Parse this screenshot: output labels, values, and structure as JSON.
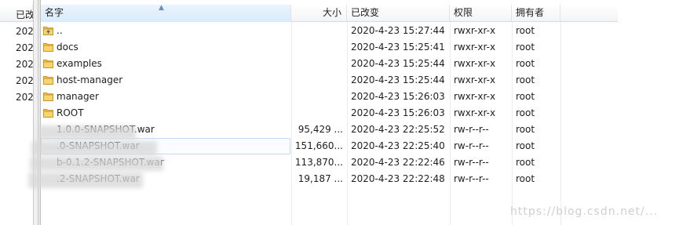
{
  "left_pane": {
    "header": "已改",
    "rows": [
      "202",
      "202",
      "202",
      "202",
      "202"
    ]
  },
  "columns": {
    "name": "名字",
    "size": "大小",
    "modified": "已改变",
    "permissions": "权限",
    "owner": "拥有者"
  },
  "files": [
    {
      "type": "parent",
      "name": "..",
      "size": "",
      "modified": "2020-4-23 15:27:44",
      "permissions": "rwxr-xr-x",
      "owner": "root"
    },
    {
      "type": "folder",
      "name": "docs",
      "size": "",
      "modified": "2020-4-23 15:25:41",
      "permissions": "rwxr-xr-x",
      "owner": "root"
    },
    {
      "type": "folder",
      "name": "examples",
      "size": "",
      "modified": "2020-4-23 15:25:44",
      "permissions": "rwxr-xr-x",
      "owner": "root"
    },
    {
      "type": "folder",
      "name": "host-manager",
      "size": "",
      "modified": "2020-4-23 15:25:44",
      "permissions": "rwxr-xr-x",
      "owner": "root"
    },
    {
      "type": "folder",
      "name": "manager",
      "size": "",
      "modified": "2020-4-23 15:26:03",
      "permissions": "rwxr-xr-x",
      "owner": "root"
    },
    {
      "type": "folder",
      "name": "ROOT",
      "size": "",
      "modified": "2020-4-23 15:26:03",
      "permissions": "rwxr-xr-x",
      "owner": "root"
    },
    {
      "type": "file",
      "name": "1.0.0-SNAPSHOT.war",
      "size": "95,429 ...",
      "modified": "2020-4-23 22:25:52",
      "permissions": "rw-r--r--",
      "owner": "root"
    },
    {
      "type": "file",
      "name": ".0-SNAPSHOT.war",
      "size": "151,660...",
      "modified": "2020-4-23 22:25:40",
      "permissions": "rw-r--r--",
      "owner": "root"
    },
    {
      "type": "file",
      "name": "b-0.1.2-SNAPSHOT.war",
      "size": "113,870...",
      "modified": "2020-4-23 22:22:46",
      "permissions": "rw-r--r--",
      "owner": "root"
    },
    {
      "type": "file",
      "name": ".2-SNAPSHOT.war",
      "size": "19,187 ...",
      "modified": "2020-4-23 22:22:48",
      "permissions": "rw-r--r--",
      "owner": "root"
    }
  ],
  "watermark": "https://blog.csdn.net/..."
}
